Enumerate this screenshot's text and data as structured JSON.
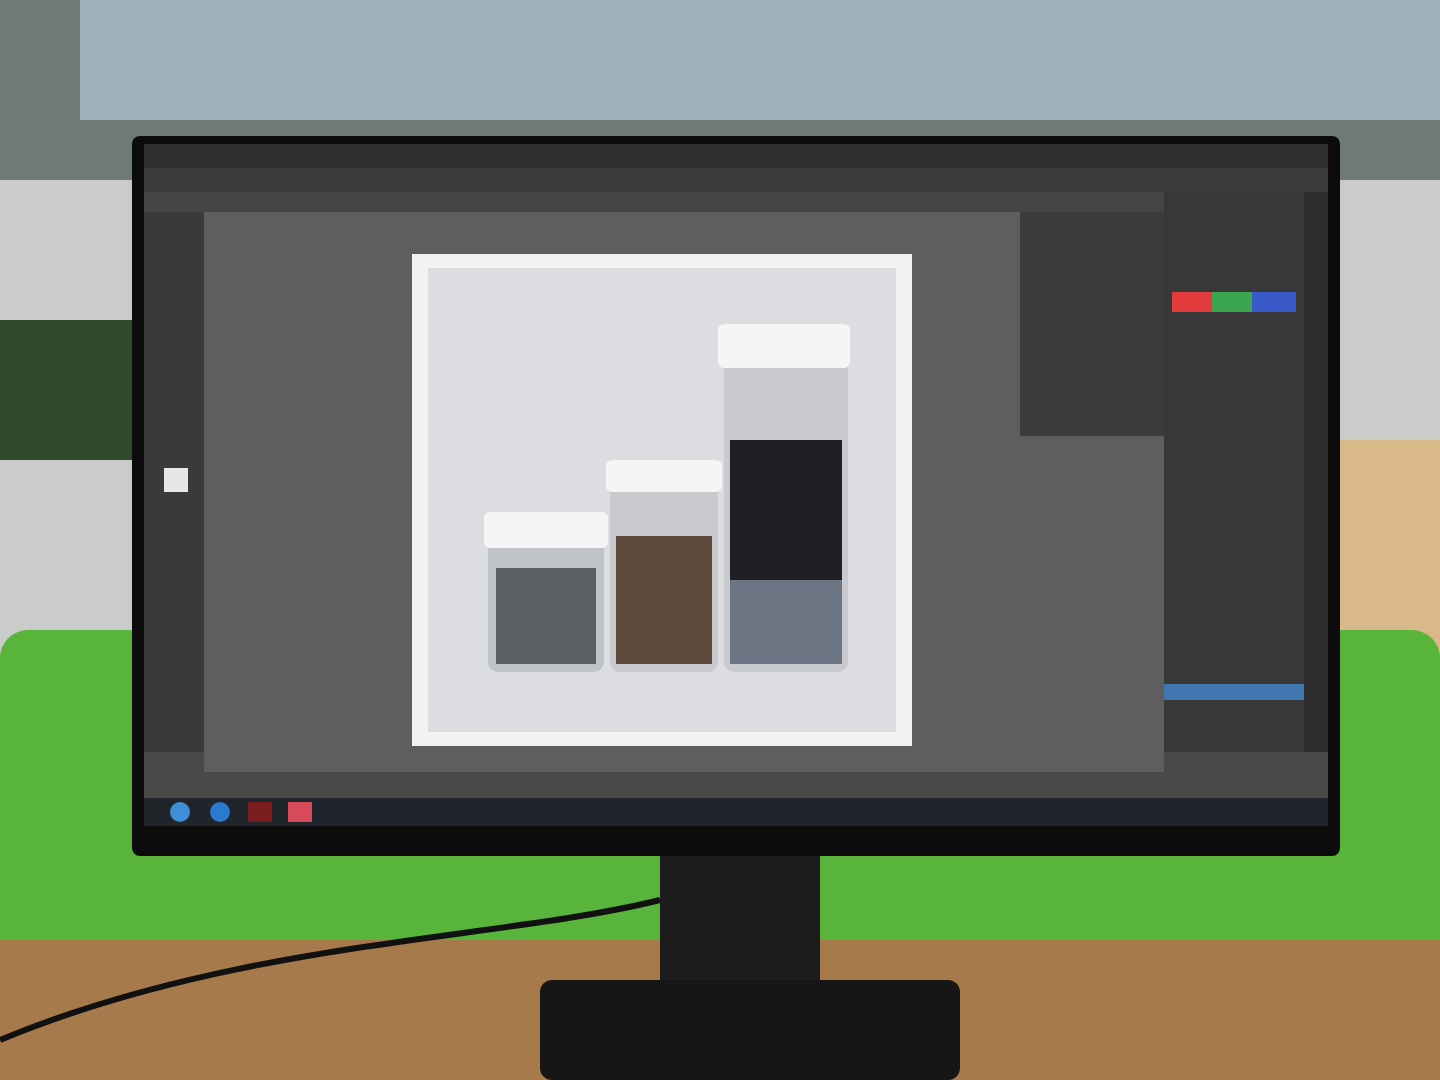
{
  "scene": {
    "kind": "monitor-photo"
  }
}
